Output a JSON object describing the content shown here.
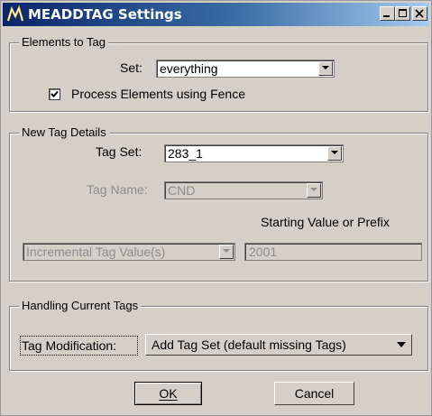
{
  "window": {
    "title": "MEADDTAG Settings",
    "minimize_label": "minimize",
    "maximize_label": "maximize",
    "close_label": "close"
  },
  "elements_to_tag": {
    "group_label": "Elements to Tag",
    "set_label": "Set:",
    "set_value": "everything",
    "process_fence_label": "Process Elements using Fence",
    "process_fence_checked": true
  },
  "new_tag_details": {
    "group_label": "New Tag Details",
    "tag_set_label": "Tag Set:",
    "tag_set_value": "283_1",
    "tag_name_label": "Tag Name:",
    "tag_name_value": "CND",
    "starting_value_label": "Starting Value or Prefix",
    "value_mode": "Incremental Tag Value(s)",
    "starting_value": "2001"
  },
  "handling_current_tags": {
    "group_label": "Handling Current Tags",
    "tag_modification_label": "Tag Modification:",
    "mode_value": "Add Tag Set (default missing Tags)"
  },
  "buttons": {
    "ok": "OK",
    "cancel": "Cancel"
  },
  "colors": {
    "face": "#d4d0c8",
    "title_start": "#0a246a",
    "title_end": "#a6caf0",
    "disabled_text": "#8c8c8c"
  }
}
